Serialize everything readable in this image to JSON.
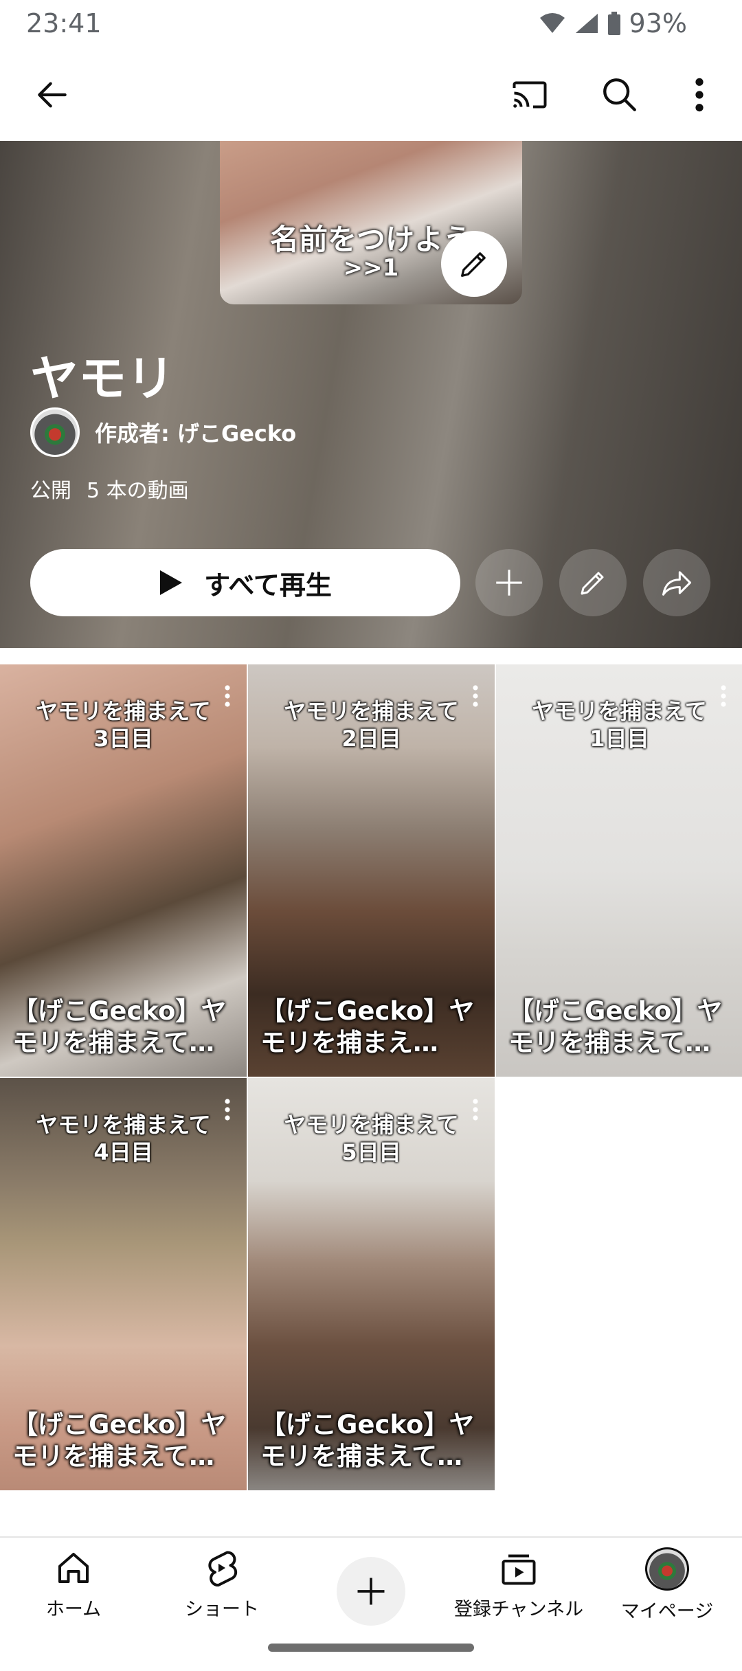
{
  "status_bar": {
    "time": "23:41",
    "battery": "93%"
  },
  "app_bar": {
    "icons": [
      "back-arrow-icon",
      "cast-icon",
      "search-icon",
      "more-vert-icon"
    ]
  },
  "playlist": {
    "thumb_text_line1": "名前をつけよう",
    "thumb_text_line2": ">>1",
    "title": "ヤモリ",
    "owner_label": "作成者: げこGecko",
    "visibility": "公開",
    "video_count": "5 本の動画",
    "play_all_label": "すべて再生"
  },
  "videos": [
    {
      "caption": "ヤモリを捕まえて\n3日目",
      "title": "【げこGecko】ヤモリを捕まえて…"
    },
    {
      "caption": "ヤモリを捕まえて\n2日目",
      "title": "【げこGecko】ヤモリを捕まえ…"
    },
    {
      "caption": "ヤモリを捕まえて\n1日目",
      "title": "【げこGecko】ヤモリを捕まえて…"
    },
    {
      "caption": "ヤモリを捕まえて\n4日目",
      "title": "【げこGecko】ヤモリを捕まえて…"
    },
    {
      "caption": "ヤモリを捕まえて\n5日目",
      "title": "【げこGecko】ヤモリを捕まえて…"
    }
  ],
  "bottom_nav": {
    "home": "ホーム",
    "shorts": "ショート",
    "subscriptions": "登録チャンネル",
    "mypage": "マイページ"
  },
  "colors": {
    "accent": "#0f0f0f",
    "hero_bg": "#6e675e"
  }
}
